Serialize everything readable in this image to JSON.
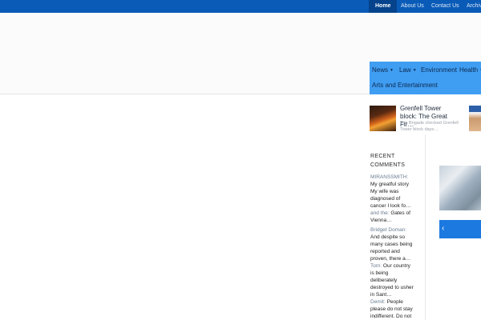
{
  "topnav": {
    "items": [
      {
        "label": "Home",
        "active": true
      },
      {
        "label": "About Us",
        "active": false
      },
      {
        "label": "Contact Us",
        "active": false
      },
      {
        "label": "Archiv",
        "active": false
      }
    ]
  },
  "mainnav": {
    "items": [
      "News",
      "Law",
      "Environment",
      "Health",
      "Arts and Entertainment"
    ]
  },
  "featured": {
    "title": "Grenfell Tower block: The Great Fir…",
    "excerpt": "Fire Brigade checked Grenfell Tower block days…"
  },
  "recent_comments": {
    "title": "RECENT COMMENTS",
    "items": [
      {
        "author": "MIRANSSMITH:",
        "text": "My greatful story My wife was diagnosed of cancer I look fo…"
      },
      {
        "author": "and the:",
        "text": "Gates of Vienna…"
      },
      {
        "author": "Bridget Doman:",
        "text": "And despite so many cases being reported and proven, there a…"
      },
      {
        "author": "Tom:",
        "text": "Our country is being deliberately destroyed to usher in Sant…"
      },
      {
        "author": "Demit:",
        "text": "People please do not stay indifferent. Do not"
      }
    ]
  },
  "slider": {
    "prev_icon": "chevron-left-icon"
  },
  "colors": {
    "topbar": "#0a5bb8",
    "topbar_active": "#05438c",
    "mainnav": "#3f9df2",
    "slider_bar": "#1c79e0"
  }
}
